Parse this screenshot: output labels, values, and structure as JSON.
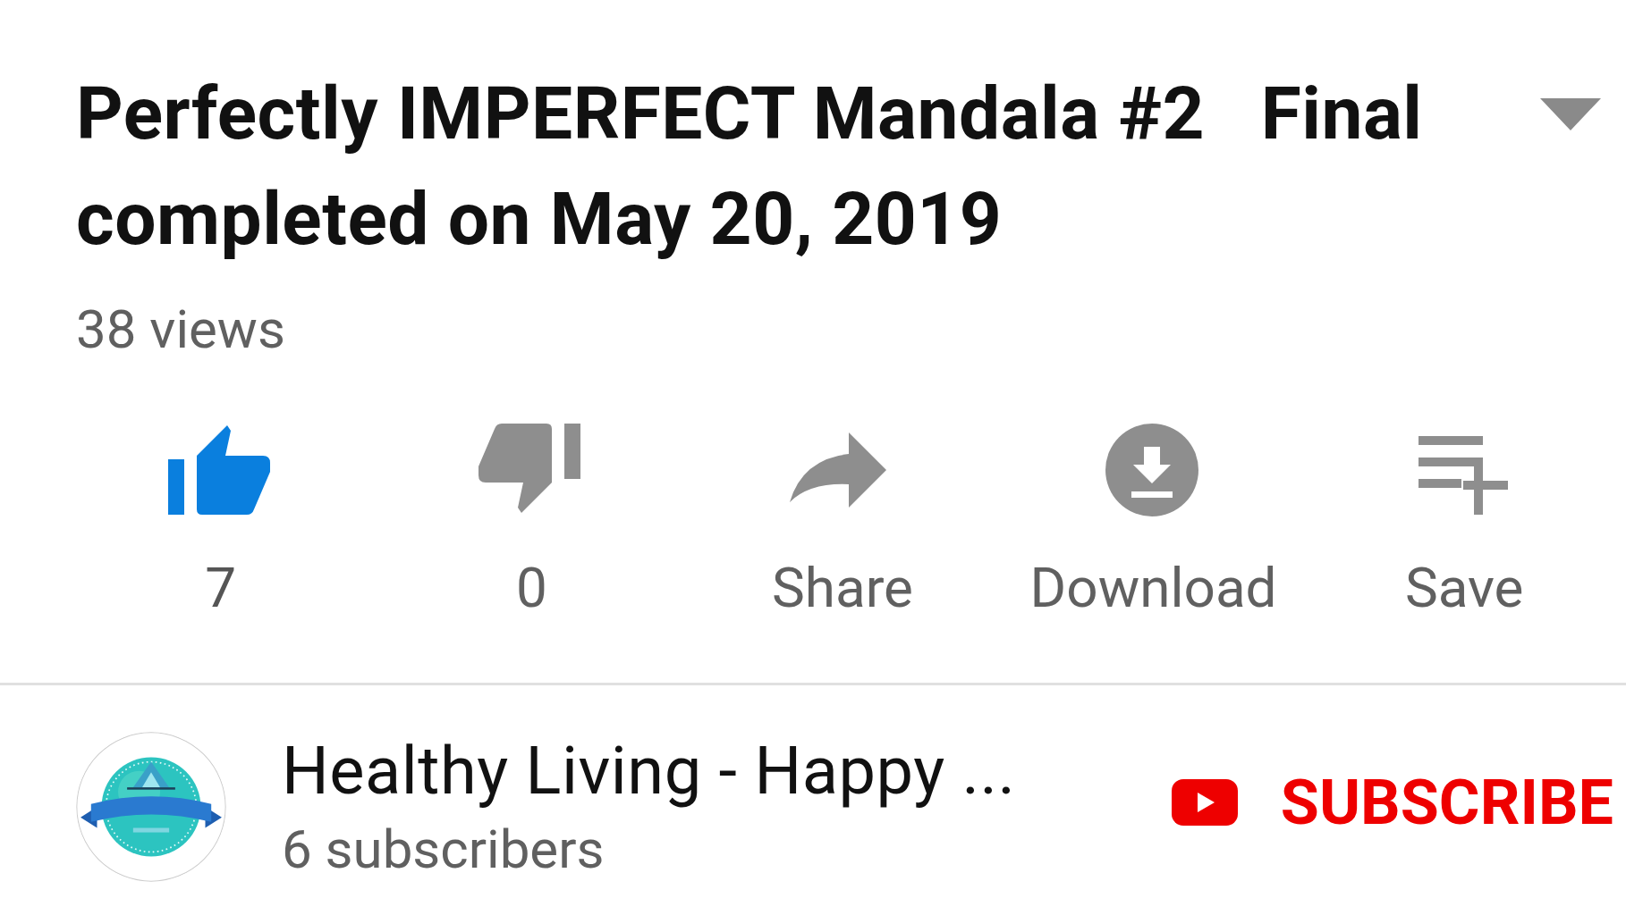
{
  "video": {
    "title": "Perfectly IMPERFECT Mandala #2   Final completed on May 20, 2019",
    "views": "38 views"
  },
  "actions": [
    {
      "kind": "like",
      "label": "7",
      "selected": true
    },
    {
      "kind": "dislike",
      "label": "0",
      "selected": false
    },
    {
      "kind": "share",
      "label": "Share"
    },
    {
      "kind": "download",
      "label": "Download"
    },
    {
      "kind": "save",
      "label": "Save"
    }
  ],
  "channel": {
    "name": "Healthy Living - Happy ...",
    "subscribers": "6 subscribers",
    "subscribe": "SUBSCRIBE"
  }
}
